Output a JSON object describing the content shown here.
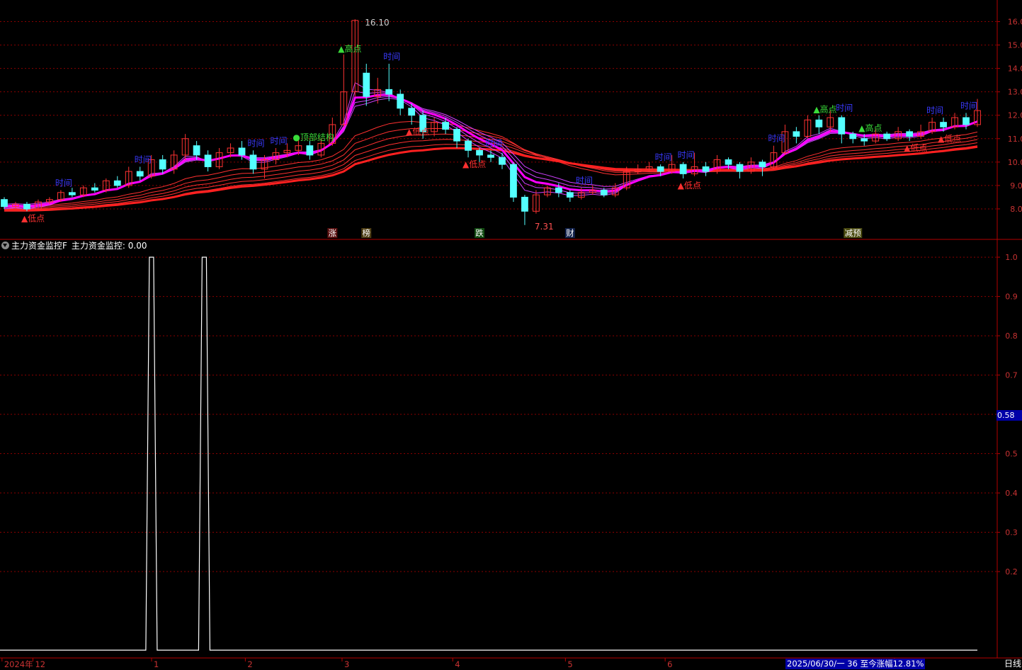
{
  "chart_data": [
    {
      "type": "candlestick",
      "title": "",
      "y_ticks": [
        "16.0",
        "15.0",
        "14.0",
        "13.0",
        "12.0",
        "11.0",
        "10.0",
        "9.0",
        "8.0"
      ],
      "ylim": [
        7.0,
        16.5
      ],
      "x_labels": [
        "2024年",
        "12",
        "1",
        "2",
        "3",
        "4",
        "5",
        "6",
        "3"
      ],
      "high_label": "16.10",
      "low_label": "7.31",
      "signals": [
        {
          "i": 2,
          "text": "低点",
          "kind": "low",
          "color": "#ff3030"
        },
        {
          "i": 5,
          "text": "时间",
          "kind": "time",
          "color": "#3a3aff"
        },
        {
          "i": 12,
          "text": "时间",
          "kind": "time",
          "color": "#3a3aff"
        },
        {
          "i": 22,
          "text": "时间",
          "kind": "time",
          "color": "#3a3aff"
        },
        {
          "i": 24,
          "text": "时间",
          "kind": "time",
          "color": "#3a3aff"
        },
        {
          "i": 26,
          "text": "顶部结构",
          "kind": "top",
          "color": "#3adc3a"
        },
        {
          "i": 30,
          "text": "高点",
          "kind": "high",
          "color": "#3adc3a"
        },
        {
          "i": 34,
          "text": "时间",
          "kind": "time",
          "color": "#3a3aff"
        },
        {
          "i": 36,
          "text": "低点",
          "kind": "low",
          "color": "#ff3030"
        },
        {
          "i": 41,
          "text": "低点",
          "kind": "low",
          "color": "#ff3030"
        },
        {
          "i": 43,
          "text": "时间",
          "kind": "time",
          "color": "#3a3aff"
        },
        {
          "i": 51,
          "text": "时间",
          "kind": "time",
          "color": "#3a3aff"
        },
        {
          "i": 58,
          "text": "时间",
          "kind": "time",
          "color": "#3a3aff"
        },
        {
          "i": 60,
          "text": "时间",
          "kind": "time",
          "color": "#3a3aff"
        },
        {
          "i": 60,
          "text": "低点",
          "kind": "low",
          "color": "#ff3030"
        },
        {
          "i": 68,
          "text": "时间",
          "kind": "time",
          "color": "#3a3aff"
        },
        {
          "i": 72,
          "text": "高点",
          "kind": "high",
          "color": "#3adc3a"
        },
        {
          "i": 74,
          "text": "时间",
          "kind": "time",
          "color": "#3a3aff"
        },
        {
          "i": 76,
          "text": "高点",
          "kind": "high",
          "color": "#3adc3a"
        },
        {
          "i": 80,
          "text": "低点",
          "kind": "low",
          "color": "#ff3030"
        },
        {
          "i": 83,
          "text": "低点",
          "kind": "low",
          "color": "#ff3030"
        },
        {
          "i": 82,
          "text": "时间",
          "kind": "time",
          "color": "#3a3aff"
        },
        {
          "i": 85,
          "text": "时间",
          "kind": "time",
          "color": "#3a3aff"
        }
      ],
      "events": [
        {
          "i": 29,
          "text": "涨",
          "bg": "#5a1010",
          "fg": "#ffffff"
        },
        {
          "i": 32,
          "text": "榜",
          "bg": "#4a3a10",
          "fg": "#ffffff"
        },
        {
          "i": 42,
          "text": "跌",
          "bg": "#104a10",
          "fg": "#ffffff"
        },
        {
          "i": 50,
          "text": "财",
          "bg": "#10204a",
          "fg": "#ffffff"
        },
        {
          "i": 75,
          "text": "减预",
          "bg": "#4a4a10",
          "fg": "#ffffff"
        }
      ],
      "candles": [
        [
          8.4,
          8.1,
          8.5,
          8.0
        ],
        [
          8.1,
          8.2,
          8.3,
          8.0
        ],
        [
          8.2,
          8.0,
          8.3,
          7.9
        ],
        [
          8.0,
          8.3,
          8.4,
          7.95
        ],
        [
          8.3,
          8.4,
          8.5,
          8.2
        ],
        [
          8.4,
          8.7,
          8.8,
          8.3
        ],
        [
          8.7,
          8.6,
          8.9,
          8.5
        ],
        [
          8.6,
          8.9,
          9.0,
          8.5
        ],
        [
          8.9,
          8.8,
          9.1,
          8.7
        ],
        [
          8.8,
          9.2,
          9.3,
          8.7
        ],
        [
          9.2,
          9.0,
          9.4,
          8.9
        ],
        [
          9.0,
          9.6,
          9.8,
          8.9
        ],
        [
          9.6,
          9.4,
          9.8,
          9.2
        ],
        [
          9.4,
          10.1,
          10.3,
          9.3
        ],
        [
          10.1,
          9.7,
          10.3,
          9.5
        ],
        [
          9.7,
          10.3,
          10.5,
          9.5
        ],
        [
          10.3,
          11.0,
          11.2,
          10.1
        ],
        [
          10.7,
          10.3,
          10.9,
          10.1
        ],
        [
          10.3,
          9.8,
          10.5,
          9.6
        ],
        [
          9.8,
          10.4,
          10.6,
          9.7
        ],
        [
          10.4,
          10.6,
          10.8,
          10.2
        ],
        [
          10.6,
          10.3,
          10.9,
          10.1
        ],
        [
          10.3,
          9.7,
          10.5,
          9.5
        ],
        [
          9.7,
          10.1,
          10.3,
          9.3
        ],
        [
          10.1,
          10.4,
          10.6,
          9.9
        ],
        [
          10.4,
          10.5,
          10.8,
          10.2
        ],
        [
          10.5,
          10.7,
          11.0,
          10.3
        ],
        [
          10.7,
          10.3,
          10.9,
          10.1
        ],
        [
          10.3,
          10.8,
          11.0,
          10.2
        ],
        [
          10.8,
          11.6,
          11.9,
          10.7
        ],
        [
          11.6,
          13.0,
          14.6,
          11.5
        ],
        [
          13.0,
          16.05,
          16.1,
          12.8
        ],
        [
          13.8,
          12.8,
          14.2,
          12.4
        ],
        [
          12.8,
          13.1,
          13.6,
          12.5
        ],
        [
          13.1,
          12.9,
          14.2,
          12.6
        ],
        [
          12.9,
          12.3,
          13.1,
          12.0
        ],
        [
          12.3,
          12.0,
          12.5,
          11.6
        ],
        [
          12.0,
          11.3,
          12.2,
          11.0
        ],
        [
          11.3,
          11.7,
          11.9,
          11.1
        ],
        [
          11.7,
          11.4,
          11.9,
          11.2
        ],
        [
          11.4,
          10.9,
          11.5,
          10.6
        ],
        [
          10.9,
          10.5,
          11.0,
          10.2
        ],
        [
          10.5,
          10.3,
          10.6,
          10.0
        ],
        [
          10.3,
          10.2,
          10.5,
          10.0
        ],
        [
          10.2,
          9.9,
          10.4,
          9.7
        ],
        [
          9.9,
          8.5,
          10.0,
          8.3
        ],
        [
          8.5,
          7.9,
          8.6,
          7.31
        ],
        [
          7.9,
          8.6,
          8.8,
          7.8
        ],
        [
          8.6,
          8.9,
          9.0,
          8.5
        ],
        [
          8.9,
          8.7,
          9.1,
          8.5
        ],
        [
          8.7,
          8.5,
          8.8,
          8.3
        ],
        [
          8.5,
          8.7,
          8.9,
          8.4
        ],
        [
          8.7,
          8.8,
          9.0,
          8.6
        ],
        [
          8.8,
          8.6,
          8.9,
          8.5
        ],
        [
          8.6,
          8.9,
          9.1,
          8.5
        ],
        [
          8.9,
          9.6,
          9.8,
          8.8
        ],
        [
          9.6,
          9.7,
          9.9,
          9.5
        ],
        [
          9.7,
          9.8,
          10.0,
          9.6
        ],
        [
          9.8,
          9.6,
          9.9,
          9.4
        ],
        [
          9.6,
          9.9,
          10.3,
          9.5
        ],
        [
          9.9,
          9.5,
          10.0,
          9.3
        ],
        [
          9.5,
          9.8,
          10.4,
          9.4
        ],
        [
          9.8,
          9.6,
          10.0,
          9.4
        ],
        [
          9.6,
          10.1,
          10.3,
          9.5
        ],
        [
          10.1,
          9.9,
          10.2,
          9.7
        ],
        [
          9.9,
          9.6,
          10.0,
          9.3
        ],
        [
          9.6,
          10.0,
          10.2,
          9.5
        ],
        [
          10.0,
          9.8,
          10.1,
          9.4
        ],
        [
          9.8,
          10.4,
          10.7,
          9.7
        ],
        [
          10.4,
          11.3,
          11.6,
          10.3
        ],
        [
          11.3,
          11.1,
          11.5,
          10.8
        ],
        [
          11.1,
          11.8,
          12.0,
          11.0
        ],
        [
          11.8,
          11.5,
          12.0,
          11.2
        ],
        [
          11.5,
          11.9,
          12.2,
          11.3
        ],
        [
          11.9,
          11.2,
          12.0,
          10.8
        ],
        [
          11.2,
          11.0,
          11.3,
          10.8
        ],
        [
          11.0,
          10.9,
          11.2,
          10.7
        ],
        [
          10.9,
          11.2,
          11.4,
          10.8
        ],
        [
          11.2,
          11.0,
          11.3,
          10.9
        ],
        [
          11.0,
          11.3,
          11.5,
          10.9
        ],
        [
          11.3,
          11.1,
          11.4,
          10.9
        ],
        [
          11.1,
          11.3,
          11.6,
          11.0
        ],
        [
          11.3,
          11.7,
          11.9,
          11.2
        ],
        [
          11.7,
          11.5,
          11.9,
          11.3
        ],
        [
          11.5,
          11.9,
          12.1,
          11.4
        ],
        [
          11.9,
          11.6,
          12.1,
          11.4
        ],
        [
          11.6,
          12.2,
          12.7,
          11.5
        ]
      ]
    },
    {
      "type": "line",
      "title": "主力资金监控F",
      "series_label": "主力资金监控: 0.00",
      "y_ticks": [
        "1.0",
        "0.9",
        "0.8",
        "0.7",
        "0.6",
        "0.5",
        "0.4",
        "0.3",
        "0.2"
      ],
      "ylim": [
        0.0,
        1.02
      ],
      "current_value": "0.58",
      "spikes": [
        {
          "x_frac": 0.155,
          "value": 1.0
        },
        {
          "x_frac": 0.209,
          "value": 1.0
        }
      ],
      "baseline": 0.0
    }
  ],
  "status_text": "2025/06/30/一 36 至今涨幅12.81%",
  "period_label": "日线",
  "colors": {
    "up": "#ff3232",
    "down": "#54ffff",
    "grid": "#8b0000",
    "axis": "#b40000",
    "text": "#c83232",
    "ma_hot": "#ff00ff",
    "ma_low": "#ff2020"
  }
}
